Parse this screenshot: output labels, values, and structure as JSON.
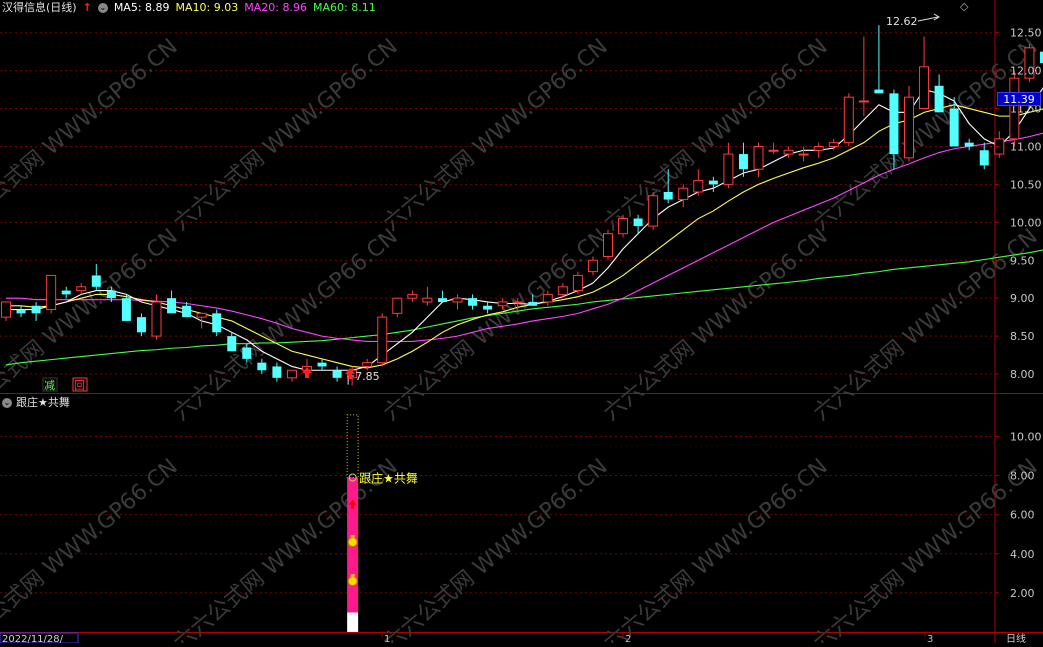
{
  "header": {
    "stock_name": "汉得信息(日线)",
    "ma5_label": "MA5:",
    "ma5_value": "8.89",
    "ma10_label": "MA10:",
    "ma10_value": "9.03",
    "ma20_label": "MA20:",
    "ma20_value": "8.96",
    "ma60_label": "MA60:",
    "ma60_value": "8.11",
    "colors": {
      "ma5": "#ffffff",
      "ma10": "#ffff55",
      "ma20": "#ff44ff",
      "ma60": "#44ff44"
    }
  },
  "indicator_header": {
    "title": "跟庄★共舞"
  },
  "current_price": "11.39",
  "markers": {
    "high_label": "12.62",
    "low_label": "7.85",
    "jian": "减",
    "hui": "回"
  },
  "price_axis": [
    "12.50",
    "12.00",
    "11.50",
    "11.00",
    "10.50",
    "10.00",
    "9.50",
    "9.00",
    "8.50",
    "8.00"
  ],
  "indicator_axis": [
    "10.00",
    "8.00",
    "6.00",
    "4.00",
    "2.00"
  ],
  "bottom_bar": {
    "date": "2022/11/28/",
    "month1": "1",
    "month2": "2",
    "month3": "3",
    "period": "日线"
  },
  "indicator_signal_label": "跟庄★共舞",
  "watermark": "六六公式网 WWW.GP66.CN",
  "chart_data": {
    "type": "candlestick",
    "price_range": [
      7.75,
      12.7
    ],
    "candles": [
      [
        8.75,
        8.95,
        8.7,
        8.95
      ],
      [
        8.85,
        8.9,
        8.75,
        8.8
      ],
      [
        8.9,
        8.95,
        8.7,
        8.8
      ],
      [
        8.85,
        9.3,
        8.8,
        9.3
      ],
      [
        9.1,
        9.15,
        9.0,
        9.05
      ],
      [
        9.1,
        9.2,
        9.05,
        9.15
      ],
      [
        9.3,
        9.45,
        9.1,
        9.15
      ],
      [
        9.1,
        9.15,
        8.95,
        9.0
      ],
      [
        9.0,
        9.05,
        8.7,
        8.7
      ],
      [
        8.75,
        8.8,
        8.5,
        8.55
      ],
      [
        8.5,
        9.05,
        8.45,
        8.95
      ],
      [
        9.0,
        9.1,
        8.8,
        8.8
      ],
      [
        8.9,
        8.95,
        8.75,
        8.75
      ],
      [
        8.75,
        8.8,
        8.6,
        8.8
      ],
      [
        8.8,
        8.85,
        8.5,
        8.55
      ],
      [
        8.5,
        8.55,
        8.3,
        8.3
      ],
      [
        8.35,
        8.4,
        8.15,
        8.2
      ],
      [
        8.15,
        8.2,
        8.0,
        8.05
      ],
      [
        8.1,
        8.15,
        7.9,
        7.95
      ],
      [
        7.95,
        8.05,
        7.9,
        8.05
      ],
      [
        8.05,
        8.2,
        8.0,
        8.1
      ],
      [
        8.15,
        8.2,
        8.05,
        8.1
      ],
      [
        8.05,
        8.1,
        7.9,
        7.95
      ],
      [
        7.95,
        8.1,
        7.85,
        8.05
      ],
      [
        8.1,
        8.2,
        8.05,
        8.15
      ],
      [
        8.15,
        8.8,
        8.1,
        8.75
      ],
      [
        8.8,
        9.0,
        8.75,
        9.0
      ],
      [
        9.0,
        9.1,
        8.95,
        9.05
      ],
      [
        8.95,
        9.15,
        8.9,
        9.0
      ],
      [
        9.0,
        9.1,
        8.95,
        8.95
      ],
      [
        8.95,
        9.05,
        8.85,
        9.0
      ],
      [
        9.0,
        9.05,
        8.85,
        8.9
      ],
      [
        8.9,
        8.95,
        8.8,
        8.85
      ],
      [
        8.9,
        9.0,
        8.85,
        8.95
      ],
      [
        8.95,
        9.0,
        8.85,
        8.95
      ],
      [
        8.95,
        9.05,
        8.9,
        8.9
      ],
      [
        8.95,
        9.1,
        8.9,
        9.05
      ],
      [
        9.05,
        9.2,
        9.0,
        9.15
      ],
      [
        9.1,
        9.35,
        9.05,
        9.3
      ],
      [
        9.35,
        9.55,
        9.3,
        9.5
      ],
      [
        9.55,
        9.9,
        9.5,
        9.85
      ],
      [
        9.85,
        10.1,
        9.8,
        10.05
      ],
      [
        10.05,
        10.1,
        9.85,
        9.95
      ],
      [
        9.95,
        10.4,
        9.9,
        10.35
      ],
      [
        10.4,
        10.7,
        10.25,
        10.3
      ],
      [
        10.3,
        10.5,
        10.2,
        10.45
      ],
      [
        10.4,
        10.7,
        10.35,
        10.55
      ],
      [
        10.55,
        10.6,
        10.4,
        10.5
      ],
      [
        10.5,
        11.05,
        10.45,
        10.9
      ],
      [
        10.9,
        11.05,
        10.6,
        10.7
      ],
      [
        10.7,
        11.05,
        10.6,
        11.0
      ],
      [
        10.95,
        11.05,
        10.9,
        10.95
      ],
      [
        10.9,
        11.0,
        10.85,
        10.95
      ],
      [
        10.9,
        11.0,
        10.8,
        10.9
      ],
      [
        10.95,
        11.05,
        10.85,
        11.0
      ],
      [
        11.0,
        11.1,
        10.95,
        11.05
      ],
      [
        11.05,
        11.7,
        11.0,
        11.65
      ],
      [
        11.6,
        12.45,
        11.4,
        11.6
      ],
      [
        11.75,
        12.6,
        11.7,
        11.7
      ],
      [
        11.7,
        11.75,
        10.7,
        10.9
      ],
      [
        10.85,
        11.8,
        10.8,
        11.65
      ],
      [
        11.5,
        12.45,
        11.5,
        12.05
      ],
      [
        11.8,
        11.95,
        11.45,
        11.45
      ],
      [
        11.5,
        11.65,
        11.0,
        11.0
      ],
      [
        11.05,
        11.1,
        10.95,
        11.0
      ],
      [
        10.95,
        11.05,
        10.7,
        10.75
      ],
      [
        10.9,
        11.2,
        10.85,
        11.1
      ],
      [
        11.1,
        12.0,
        11.0,
        11.9
      ],
      [
        11.9,
        12.35,
        11.85,
        12.3
      ],
      [
        12.25,
        12.35,
        12.0,
        12.1
      ],
      [
        12.2,
        12.35,
        12.0,
        12.2
      ],
      [
        12.2,
        12.3,
        11.35,
        11.35
      ]
    ],
    "ma5": [
      8.85,
      8.85,
      8.85,
      8.9,
      8.95,
      9.05,
      9.1,
      9.1,
      9.05,
      8.95,
      8.9,
      8.85,
      8.8,
      8.7,
      8.65,
      8.55,
      8.45,
      8.3,
      8.2,
      8.1,
      8.05,
      8.05,
      8.05,
      8.05,
      8.1,
      8.25,
      8.4,
      8.55,
      8.75,
      8.95,
      9.0,
      8.98,
      8.95,
      8.93,
      8.93,
      8.92,
      8.96,
      9.02,
      9.1,
      9.2,
      9.4,
      9.65,
      9.85,
      10.05,
      10.2,
      10.3,
      10.4,
      10.45,
      10.55,
      10.65,
      10.7,
      10.8,
      10.9,
      10.95,
      10.95,
      10.98,
      11.15,
      11.35,
      11.55,
      11.45,
      11.45,
      11.75,
      11.7,
      11.6,
      11.3,
      11.1,
      11.0,
      11.2,
      11.5,
      11.8,
      12.0,
      11.95
    ],
    "ma10": [
      8.9,
      8.9,
      8.88,
      8.9,
      8.95,
      9.0,
      9.05,
      9.05,
      9.02,
      8.98,
      8.95,
      8.9,
      8.85,
      8.8,
      8.75,
      8.7,
      8.6,
      8.5,
      8.4,
      8.3,
      8.25,
      8.2,
      8.15,
      8.1,
      8.08,
      8.12,
      8.2,
      8.3,
      8.42,
      8.55,
      8.65,
      8.72,
      8.78,
      8.82,
      8.88,
      8.92,
      8.95,
      8.98,
      9.02,
      9.08,
      9.18,
      9.3,
      9.45,
      9.6,
      9.75,
      9.9,
      10.05,
      10.15,
      10.28,
      10.4,
      10.5,
      10.58,
      10.65,
      10.72,
      10.78,
      10.85,
      10.95,
      11.05,
      11.2,
      11.3,
      11.35,
      11.45,
      11.5,
      11.55,
      11.5,
      11.45,
      11.4,
      11.4,
      11.45,
      11.5,
      11.55,
      11.55
    ],
    "ma20": [
      9.0,
      9.0,
      8.98,
      8.98,
      8.98,
      8.98,
      8.98,
      8.98,
      8.98,
      8.97,
      8.96,
      8.95,
      8.93,
      8.9,
      8.87,
      8.83,
      8.78,
      8.73,
      8.67,
      8.6,
      8.55,
      8.5,
      8.47,
      8.45,
      8.43,
      8.43,
      8.43,
      8.43,
      8.45,
      8.47,
      8.5,
      8.55,
      8.6,
      8.63,
      8.66,
      8.7,
      8.73,
      8.76,
      8.8,
      8.86,
      8.92,
      9.0,
      9.1,
      9.2,
      9.3,
      9.4,
      9.5,
      9.6,
      9.7,
      9.8,
      9.9,
      10.0,
      10.08,
      10.16,
      10.24,
      10.32,
      10.42,
      10.52,
      10.62,
      10.7,
      10.77,
      10.85,
      10.92,
      10.97,
      11.0,
      11.03,
      11.06,
      11.09,
      11.13,
      11.18,
      11.23,
      11.3
    ],
    "ma60": [
      8.12,
      8.15,
      8.17,
      8.19,
      8.21,
      8.23,
      8.25,
      8.27,
      8.29,
      8.31,
      8.32,
      8.34,
      8.35,
      8.37,
      8.38,
      8.4,
      8.4,
      8.41,
      8.41,
      8.42,
      8.43,
      8.44,
      8.46,
      8.48,
      8.5,
      8.52,
      8.55,
      8.58,
      8.62,
      8.66,
      8.7,
      8.74,
      8.77,
      8.8,
      8.83,
      8.86,
      8.88,
      8.9,
      8.92,
      8.95,
      8.97,
      8.99,
      9.01,
      9.03,
      9.05,
      9.07,
      9.09,
      9.11,
      9.13,
      9.15,
      9.17,
      9.19,
      9.21,
      9.23,
      9.26,
      9.28,
      9.3,
      9.33,
      9.35,
      9.38,
      9.4,
      9.42,
      9.44,
      9.46,
      9.48,
      9.51,
      9.54,
      9.57,
      9.6,
      9.64,
      9.68,
      9.72
    ],
    "indicator": {
      "range": [
        0,
        11.3
      ],
      "signal_index": 23,
      "bar_top": 7.9,
      "bar_bottom": 0,
      "white_top": 1.0,
      "dotted_top": 11.1
    }
  }
}
